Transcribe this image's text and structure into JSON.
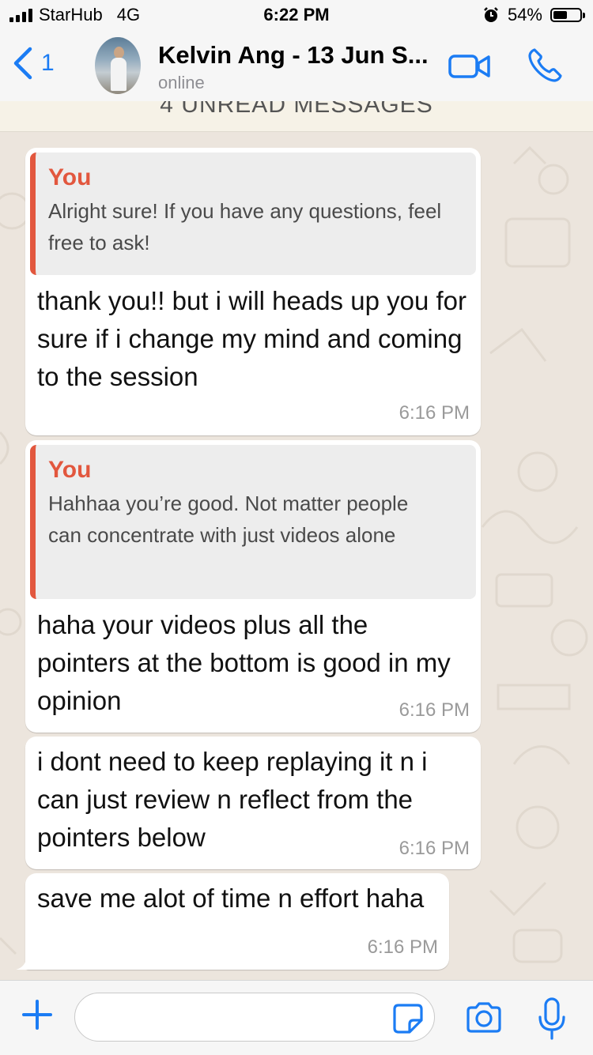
{
  "status_bar": {
    "carrier": "StarHub",
    "network": "4G",
    "time": "6:22 PM",
    "battery_percent": "54%",
    "battery_level": 0.54
  },
  "header": {
    "back_count": "1",
    "contact_name": "Kelvin Ang - 13 Jun S...",
    "status": "online",
    "accent_color": "#1b7cf4"
  },
  "unread_banner": "4 UNREAD MESSAGES",
  "messages": [
    {
      "quote_author": "You",
      "quote_text": "Alright sure! If you have any questions, feel free to ask!",
      "text": "thank you!! but i will heads up you for sure if i change my mind and coming to the session",
      "time": "6:16 PM"
    },
    {
      "quote_author": "You",
      "quote_text": "Hahhaa you’re good. Not matter people can concentrate with just videos alone",
      "text": "haha your videos plus all the pointers at the bottom is good in my opinion",
      "time": "6:16 PM"
    },
    {
      "text": "i dont need to keep replaying it n i can just review n reflect from the pointers below",
      "time": "6:16 PM"
    },
    {
      "text": "save me alot of time n effort haha",
      "time": "6:16 PM"
    }
  ],
  "input_bar": {
    "message_value": "",
    "icons": [
      "plus-icon",
      "sticker-icon",
      "camera-icon",
      "microphone-icon"
    ]
  },
  "colors": {
    "quote_accent": "#e2573e",
    "chat_background": "#ece5dd",
    "bubble_background": "#ffffff"
  }
}
